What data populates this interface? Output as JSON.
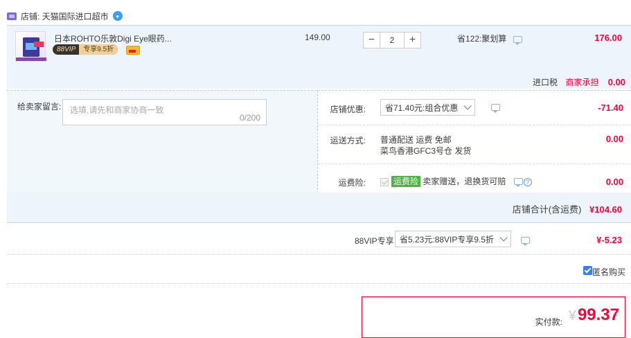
{
  "store": {
    "label": "店铺: 天猫国际进口超市"
  },
  "item": {
    "title": "日本ROHTO乐敦Digi Eye眼药...",
    "vip_badge_left": "88VIP",
    "vip_badge_right": "专享9.5折",
    "unit_price": "149.00",
    "quantity": "2",
    "minus_label": "−",
    "plus_label": "+",
    "promo": "省122:聚划算",
    "total": "176.00"
  },
  "tax": {
    "label": "进口税",
    "payer": "商家承担",
    "amount": "0.00"
  },
  "message": {
    "label": "给卖家留言:",
    "placeholder": "选填,请先和商家协商一致",
    "count": "0/200"
  },
  "store_discount": {
    "label": "店铺优惠:",
    "selected": "省71.40元:组合优惠",
    "amount": "-71.40"
  },
  "shipping": {
    "label": "运送方式:",
    "line1": "普通配送 运费 免邮",
    "line2": "菜鸟香港GFC3号仓  发货",
    "amount": "0.00"
  },
  "insurance": {
    "label": "运费险:",
    "badge": "运费险",
    "text": "卖家赠送，退换货可赔",
    "help": "?",
    "amount": "0.00"
  },
  "subtotal": {
    "label": "店铺合计(含运费)",
    "amount": "¥104.60"
  },
  "vip": {
    "label": "88VIP专享",
    "selected": "省5.23元:88VIP专享9.5折",
    "amount": "¥-5.23"
  },
  "anonymous": {
    "label": "匿名购买"
  },
  "payment": {
    "label": "实付款:",
    "currency": "¥",
    "amount": "99.37"
  },
  "colors": {
    "accent_red": "#ff0036",
    "block_blue": "#eef4fb",
    "checkbox_blue": "#3a7ee8",
    "insurance_green": "#4bb443"
  }
}
